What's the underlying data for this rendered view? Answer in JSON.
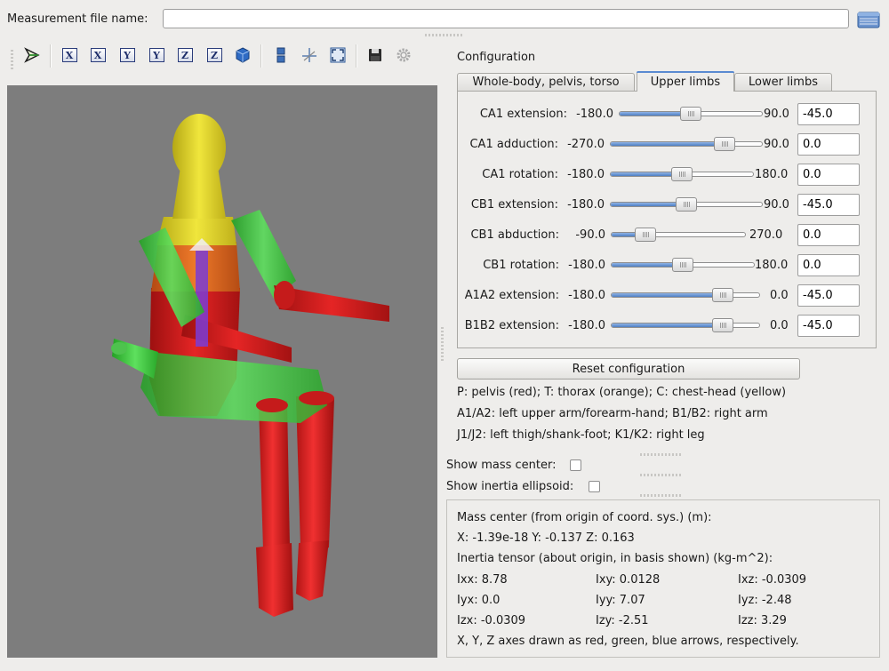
{
  "file": {
    "label": "Measurement file name:",
    "value": "",
    "browse_icon": "folder-icon"
  },
  "toolbar": {
    "icons": [
      "select-arrow-icon",
      "view-x-icon",
      "view-x-reverse-icon",
      "view-y-icon",
      "view-y-reverse-icon",
      "view-z-icon",
      "view-z-reverse-icon",
      "iso-view-icon",
      "split-view-icon",
      "axes-icon",
      "zoom-fit-icon",
      "save-icon",
      "settings-icon"
    ],
    "axis_letters": [
      "X",
      "X",
      "Y",
      "Y",
      "Z",
      "Z"
    ]
  },
  "config": {
    "title": "Configuration",
    "tabs": [
      {
        "label": "Whole-body, pelvis, torso",
        "active": false
      },
      {
        "label": "Upper limbs",
        "active": true
      },
      {
        "label": "Lower limbs",
        "active": false
      }
    ],
    "sliders": [
      {
        "label": "CA1 extension:",
        "min": "-180.0",
        "max": "90.0",
        "value": "-45.0",
        "level": 0.5
      },
      {
        "label": "CA1 adduction:",
        "min": "-270.0",
        "max": "90.0",
        "value": "0.0",
        "level": 0.75
      },
      {
        "label": "CA1 rotation:",
        "min": "-180.0",
        "max": "180.0",
        "value": "0.0",
        "level": 0.5
      },
      {
        "label": "CB1 extension:",
        "min": "-180.0",
        "max": "90.0",
        "value": "-45.0",
        "level": 0.5
      },
      {
        "label": "CB1 abduction:",
        "min": "-90.0",
        "max": "270.0",
        "value": "0.0",
        "level": 0.25
      },
      {
        "label": "CB1 rotation:",
        "min": "-180.0",
        "max": "180.0",
        "value": "0.0",
        "level": 0.5
      },
      {
        "label": "A1A2 extension:",
        "min": "-180.0",
        "max": "0.0",
        "value": "-45.0",
        "level": 0.75
      },
      {
        "label": "B1B2 extension:",
        "min": "-180.0",
        "max": "0.0",
        "value": "-45.0",
        "level": 0.75
      }
    ],
    "reset_label": "Reset configuration",
    "legend": [
      "P: pelvis (red); T: thorax (orange); C: chest-head (yellow)",
      "A1/A2: left upper arm/forearm-hand; B1/B2: right arm",
      "J1/J2: left thigh/shank-foot; K1/K2: right leg"
    ]
  },
  "options": {
    "mass_center_label": "Show mass center:",
    "mass_center_checked": false,
    "inertia_label": "Show inertia ellipsoid:",
    "inertia_checked": false
  },
  "info": {
    "mass_center_title": "Mass center (from origin of coord. sys.) (m):",
    "mass_center_line": "X:  -1.39e-18  Y:  -0.137  Z:  0.163",
    "inertia_title": "Inertia tensor (about origin, in basis shown) (kg-m^2):",
    "tensor": [
      [
        "Ixx:  8.78",
        "Ixy:  0.0128",
        "Ixz:  -0.0309"
      ],
      [
        "Iyx:  0.0",
        "Iyy:  7.07",
        "Iyz:  -2.48"
      ],
      [
        "Izx:  -0.0309",
        "Izy:  -2.51",
        "Izz:  3.29"
      ]
    ],
    "axes_note": "X, Y, Z axes drawn as red, green, blue arrows, respectively."
  },
  "colors": {
    "pelvis": "#d81d1d",
    "thorax": "#e0661f",
    "head": "#e6dc2a",
    "arm_green": "#33c233",
    "viewport_bg": "#7d7d7d",
    "slider_fill": "#5a8ad1"
  }
}
